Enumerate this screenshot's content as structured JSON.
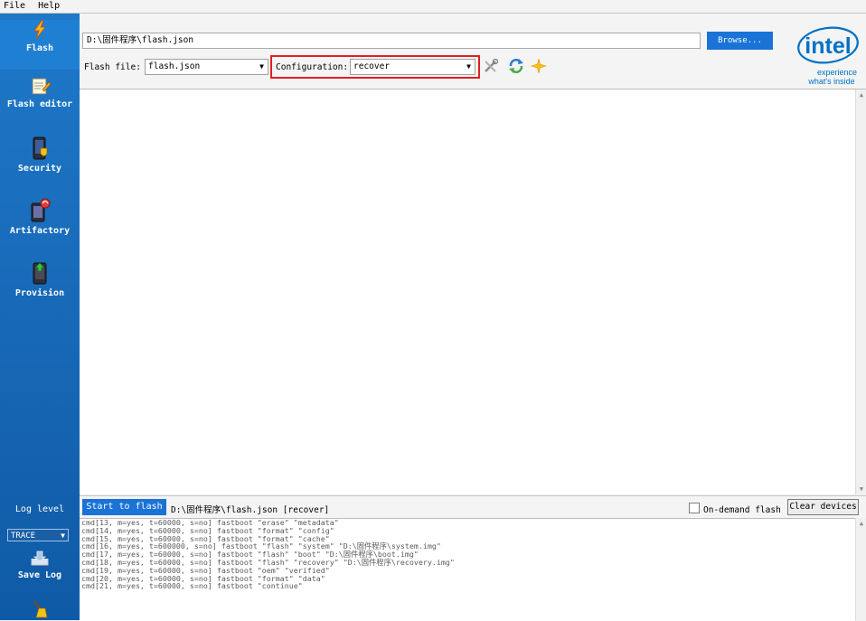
{
  "menu": [
    "File",
    "Help"
  ],
  "sidebar": {
    "items": [
      {
        "label": "Flash",
        "icon": "flash-icon",
        "active": true
      },
      {
        "label": "Flash editor",
        "icon": "edit-notepad-icon",
        "active": false
      },
      {
        "label": "Security",
        "icon": "security-shield-icon",
        "active": false
      },
      {
        "label": "Artifactory",
        "icon": "artifactory-icon",
        "active": false
      },
      {
        "label": "Provision",
        "icon": "provision-icon",
        "active": false
      }
    ],
    "log_level_label": "Log level",
    "log_level_value": "TRACE",
    "save_log_label": "Save Log"
  },
  "top": {
    "path_value": "D:\\固件程序\\flash.json",
    "browse_label": "Browse...",
    "flash_file_label": "Flash file:",
    "flash_file_value": "flash.json",
    "configuration_label": "Configuration:",
    "configuration_value": "recover",
    "logo_brand": "intel",
    "logo_tagline_1": "experience",
    "logo_tagline_2": "what's inside"
  },
  "action_bar": {
    "start_label": "Start to flash",
    "status": "D:\\固件程序\\flash.json [recover]",
    "on_demand_label": "On-demand flash",
    "clear_label": "Clear devices"
  },
  "log_lines": [
    "cmd[13, m=yes, t=60000, s=no] fastboot \"erase\" \"metadata\"",
    "cmd[14, m=yes, t=60000, s=no] fastboot \"format\" \"config\"",
    "cmd[15, m=yes, t=60000, s=no] fastboot \"format\" \"cache\"",
    "cmd[16, m=yes, t=600000, s=no] fastboot \"flash\" \"system\" \"D:\\固件程序\\system.img\"",
    "cmd[17, m=yes, t=60000, s=no] fastboot \"flash\" \"boot\" \"D:\\固件程序\\boot.img\"",
    "cmd[18, m=yes, t=60000, s=no] fastboot \"flash\" \"recovery\" \"D:\\固件程序\\recovery.img\"",
    "cmd[19, m=yes, t=60000, s=no] fastboot \"oem\" \"verified\"",
    "cmd[20, m=yes, t=60000, s=no] fastboot \"format\" \"data\"",
    "cmd[21, m=yes, t=60000, s=no] fastboot \"continue\""
  ],
  "colors": {
    "sidebar": "#1666b4",
    "accent_button": "#1a73d6",
    "highlight_box": "#e02020",
    "intel_blue": "#0071c5"
  }
}
